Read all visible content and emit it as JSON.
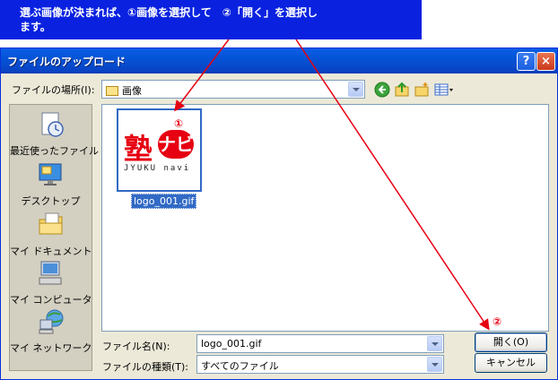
{
  "banner": {
    "line1": "選ぶ画像が決まれば、①画像を選択して　②「開く」を選択し",
    "line2": "ます。"
  },
  "dialog": {
    "title": "ファイルのアップロード",
    "help_label": "?",
    "close_label": "×"
  },
  "lookin": {
    "label": "ファイルの場所(I):",
    "value": "画像"
  },
  "places": [
    {
      "label": "最近使ったファイル",
      "icon": "recent-documents-icon"
    },
    {
      "label": "デスクトップ",
      "icon": "desktop-icon"
    },
    {
      "label": "マイ ドキュメント",
      "icon": "my-documents-icon"
    },
    {
      "label": "マイ コンピュータ",
      "icon": "my-computer-icon"
    },
    {
      "label": "マイ ネットワーク",
      "icon": "my-network-icon"
    }
  ],
  "file": {
    "name": "logo_001.gif",
    "logo_text": "塾ナビ",
    "logo_main": "塾",
    "logo_accent": "ナビ",
    "logo_sub": "JYUKU navi",
    "marker": "①"
  },
  "filename": {
    "label": "ファイル名(N):",
    "value": "logo_001.gif"
  },
  "filetype": {
    "label": "ファイルの種類(T):",
    "value": "すべてのファイル"
  },
  "buttons": {
    "open": "開く(O)",
    "cancel": "キャンセル"
  },
  "marker2": "②",
  "colors": {
    "banner": "#0a22e0",
    "annotation": "#e60012",
    "selection": "#316ac5"
  }
}
